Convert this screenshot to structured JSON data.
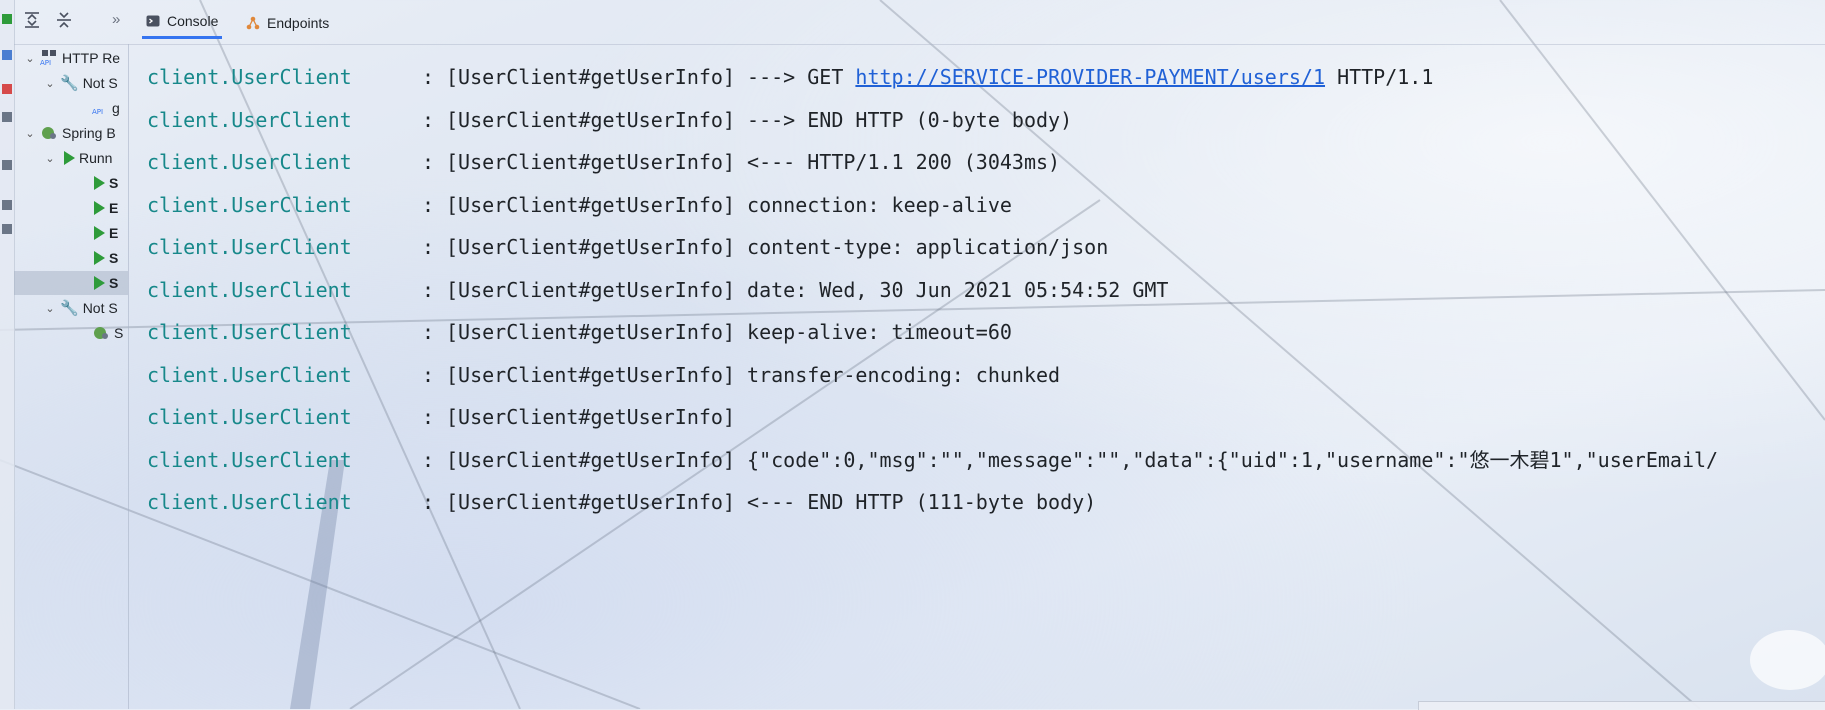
{
  "toolbar": {
    "expand_all_icon": "expand-all-icon",
    "collapse_all_icon": "collapse-all-icon",
    "more_label": "»"
  },
  "tabs": [
    {
      "label": "Console",
      "icon": "console-icon",
      "active": true
    },
    {
      "label": "Endpoints",
      "icon": "endpoints-icon",
      "active": false
    }
  ],
  "tree": {
    "items": [
      {
        "label": "HTTP Re",
        "icon": "api-icon",
        "expanded": true
      },
      {
        "label": "Not S",
        "icon": "wrench-icon",
        "expanded": true
      },
      {
        "label": "g",
        "icon": "api-icon"
      },
      {
        "label": "Spring B",
        "icon": "spring-boot-icon",
        "expanded": true
      },
      {
        "label": "Runn",
        "icon": "run-icon",
        "expanded": true
      },
      {
        "label": "S",
        "icon": "run-icon"
      },
      {
        "label": "E",
        "icon": "run-icon"
      },
      {
        "label": "E",
        "icon": "run-icon"
      },
      {
        "label": "S",
        "icon": "run-icon"
      },
      {
        "label": "S",
        "icon": "run-icon",
        "selected": true
      },
      {
        "label": "Not S",
        "icon": "wrench-icon",
        "expanded": true
      },
      {
        "label": "S",
        "icon": "spring-boot-icon"
      }
    ]
  },
  "console": {
    "lines": [
      {
        "logger": "client.UserClient",
        "sep": ":",
        "tag": "[UserClient#getUserInfo]",
        "before": "---> GET",
        "link": "http://SERVICE-PROVIDER-PAYMENT/users/1",
        "after": "HTTP/1.1"
      },
      {
        "logger": "client.UserClient",
        "sep": ":",
        "tag": "[UserClient#getUserInfo]",
        "before": "---> END HTTP (0-byte body)",
        "link": "",
        "after": ""
      },
      {
        "logger": "client.UserClient",
        "sep": ":",
        "tag": "[UserClient#getUserInfo]",
        "before": "<--- HTTP/1.1 200 (3043ms)",
        "link": "",
        "after": ""
      },
      {
        "logger": "client.UserClient",
        "sep": ":",
        "tag": "[UserClient#getUserInfo]",
        "before": "connection: keep-alive",
        "link": "",
        "after": ""
      },
      {
        "logger": "client.UserClient",
        "sep": ":",
        "tag": "[UserClient#getUserInfo]",
        "before": "content-type: application/json",
        "link": "",
        "after": ""
      },
      {
        "logger": "client.UserClient",
        "sep": ":",
        "tag": "[UserClient#getUserInfo]",
        "before": "date: Wed, 30 Jun 2021 05:54:52 GMT",
        "link": "",
        "after": ""
      },
      {
        "logger": "client.UserClient",
        "sep": ":",
        "tag": "[UserClient#getUserInfo]",
        "before": "keep-alive: timeout=60",
        "link": "",
        "after": ""
      },
      {
        "logger": "client.UserClient",
        "sep": ":",
        "tag": "[UserClient#getUserInfo]",
        "before": "transfer-encoding: chunked",
        "link": "",
        "after": ""
      },
      {
        "logger": "client.UserClient",
        "sep": ":",
        "tag": "[UserClient#getUserInfo]",
        "before": "",
        "link": "",
        "after": ""
      },
      {
        "logger": "client.UserClient",
        "sep": ":",
        "tag": "[UserClient#getUserInfo]",
        "before": "{\"code\":0,\"msg\":\"\",\"message\":\"\",\"data\":{\"uid\":1,\"username\":\"悠一木碧1\",\"userEmail/",
        "link": "",
        "after": ""
      },
      {
        "logger": "client.UserClient",
        "sep": ":",
        "tag": "[UserClient#getUserInfo]",
        "before": "<--- END HTTP (111-byte body)",
        "link": "",
        "after": ""
      }
    ]
  }
}
